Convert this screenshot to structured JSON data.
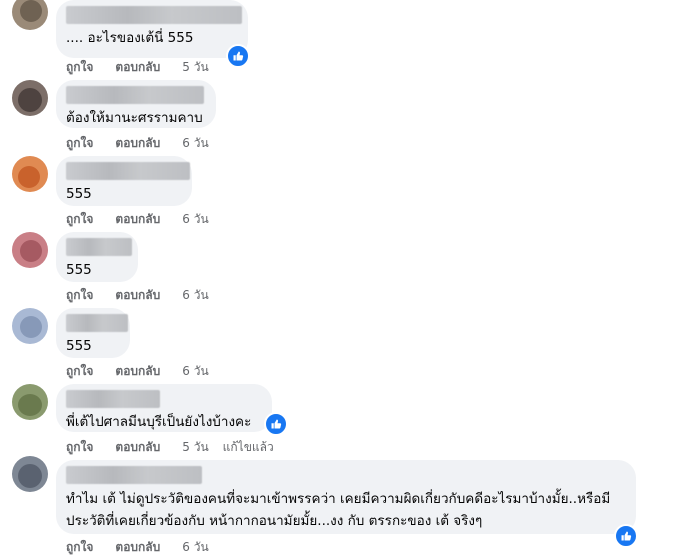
{
  "ui": {
    "like_label": "ถูกใจ",
    "reply_label": "ตอบกลับ",
    "edited_label": "แก้ไขแล้ว"
  },
  "colors": {
    "accent": "#1877f2",
    "bubble": "#f0f2f5",
    "meta_text": "#65676b"
  },
  "comments": [
    {
      "text": ".... อะไรของเต้นี่ 555",
      "time": "5 วัน",
      "has_reaction": true
    },
    {
      "text": "ต้องให้มานะศรรามคาบ",
      "time": "6 วัน",
      "has_reaction": false
    },
    {
      "text": "555",
      "time": "6 วัน",
      "has_reaction": false
    },
    {
      "text": "555",
      "time": "6 วัน",
      "has_reaction": false
    },
    {
      "text": "555",
      "time": "6 วัน",
      "has_reaction": false
    },
    {
      "text": "พี่เต้ไปศาลมีนบุรีเป็นยังไงบ้างคะ",
      "time": "5 วัน",
      "has_reaction": true,
      "edited": true
    },
    {
      "text": "ทำไม เต้ ไม่ดูประวัติของคนที่จะมาเข้าพรรคว่า เคยมีความผิดเกี่ยวกับคดีอะไรมาบ้างมั้ย..หรือมีประวัติที่เคยเกี่ยวข้องกับ หน้ากากอนามัยมั้ย...งง กับ ตรรกะของ เต้ จริงๆ",
      "time": "6 วัน",
      "has_reaction": true
    }
  ]
}
